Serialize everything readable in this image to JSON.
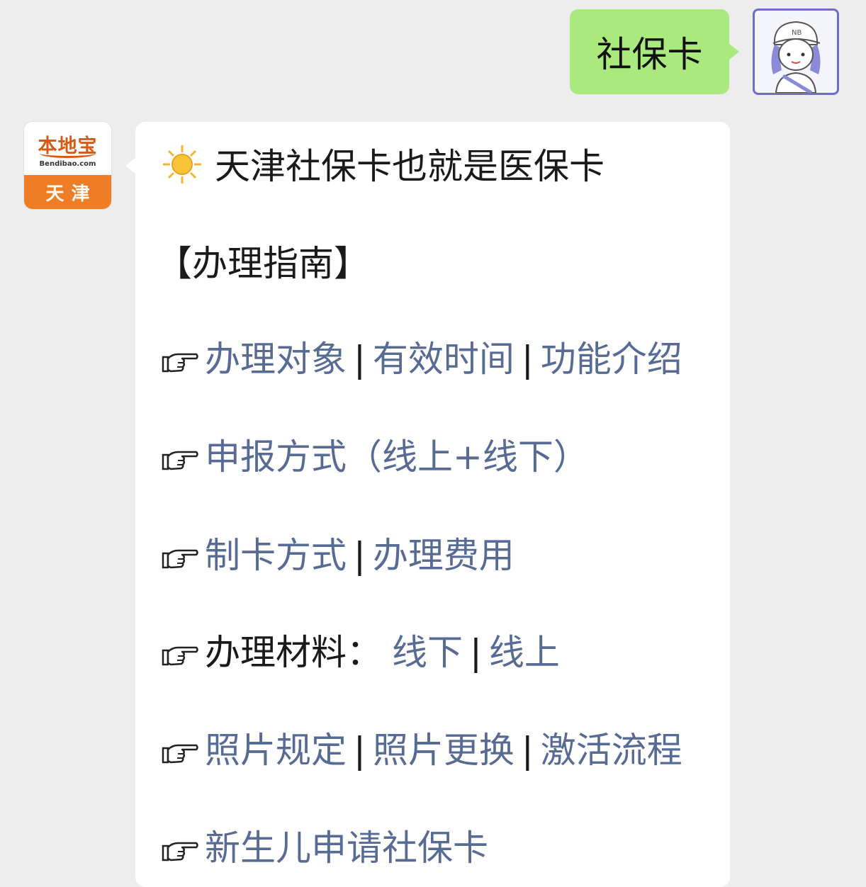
{
  "user_message": {
    "text": "社保卡"
  },
  "account": {
    "logo_title": "本地宝",
    "logo_domain": "Bendibao.com",
    "logo_city": "天津"
  },
  "reply": {
    "headline": "天津社保卡也就是医保卡",
    "guide_title": "【办理指南】",
    "rows": [
      {
        "links": [
          "办理对象",
          "有效时间",
          "功能介绍"
        ],
        "separator": "|"
      },
      {
        "links": [
          "申报方式（线上+线下）"
        ]
      },
      {
        "links": [
          "制卡方式",
          "办理费用"
        ],
        "separator": "|"
      },
      {
        "label": "办理材料：",
        "links": [
          "线下",
          "线上"
        ],
        "separator": "|"
      },
      {
        "links": [
          "照片规定",
          "照片更换",
          "激活流程"
        ],
        "separator": "|"
      },
      {
        "links": [
          "新生儿申请社保卡"
        ]
      }
    ]
  },
  "colors": {
    "background": "#ededed",
    "user_bubble": "#a9e97e",
    "link": "#576b95",
    "logo_orange": "#ef7d26"
  },
  "icons": [
    "sun-icon",
    "pointing-hand-icon"
  ]
}
